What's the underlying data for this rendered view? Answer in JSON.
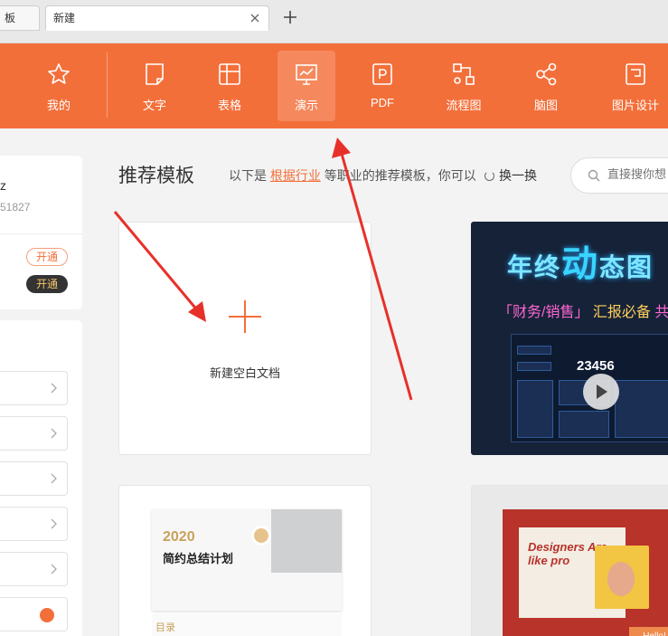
{
  "tabs": [
    {
      "label": "板"
    },
    {
      "label": "新建"
    }
  ],
  "new_tab_symbol": "+",
  "toolbar": {
    "accent_color": "#f36f3a",
    "items": [
      {
        "label": "我的",
        "icon": "star-icon"
      },
      {
        "label": "文字",
        "icon": "document-icon"
      },
      {
        "label": "表格",
        "icon": "spreadsheet-icon"
      },
      {
        "label": "演示",
        "icon": "presentation-icon",
        "active": true
      },
      {
        "label": "PDF",
        "icon": "pdf-icon"
      },
      {
        "label": "流程图",
        "icon": "flowchart-icon"
      },
      {
        "label": "脑图",
        "icon": "mindmap-icon"
      },
      {
        "label": "图片设计",
        "icon": "image-design-icon"
      }
    ]
  },
  "left_panel": {
    "user_line1": "z",
    "user_line2": "51827",
    "open_button_1": "开通",
    "open_button_2": "开通"
  },
  "main": {
    "title": "推荐模板",
    "subtitle_prefix": "以下是",
    "subtitle_link": "根据行业",
    "subtitle_suffix": "等职业的推荐模板，你可以",
    "refresh_label": "换一换",
    "search_placeholder": "直接搜你想",
    "blank_card_label": "新建空白文档",
    "video_card": {
      "title_pre": "年终",
      "title_big": "动",
      "title_post": "态图",
      "subtitle_a": "「财务/销售」",
      "subtitle_b": "汇报必备",
      "subtitle_c": "共",
      "number": "23456"
    },
    "ppt_card_1": {
      "year": "2020",
      "name": "简约总结计划",
      "toc": "目录"
    },
    "ppt_card_2": {
      "text": "Designers Are like pro",
      "hello": "Hello!"
    }
  }
}
